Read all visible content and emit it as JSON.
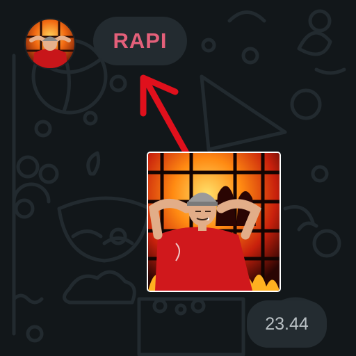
{
  "chat": {
    "contact_name": "RAPI",
    "message_time": "23.44"
  },
  "icons": {
    "avatar": "avatar",
    "arrow": "arrow-up-left",
    "photo": "photo-thumbnail"
  },
  "colors": {
    "background": "#12171a",
    "bubble": "#232b30",
    "name_accent": "#e4607a",
    "arrow": "#e0101c",
    "time_text": "#b9c0c4"
  }
}
